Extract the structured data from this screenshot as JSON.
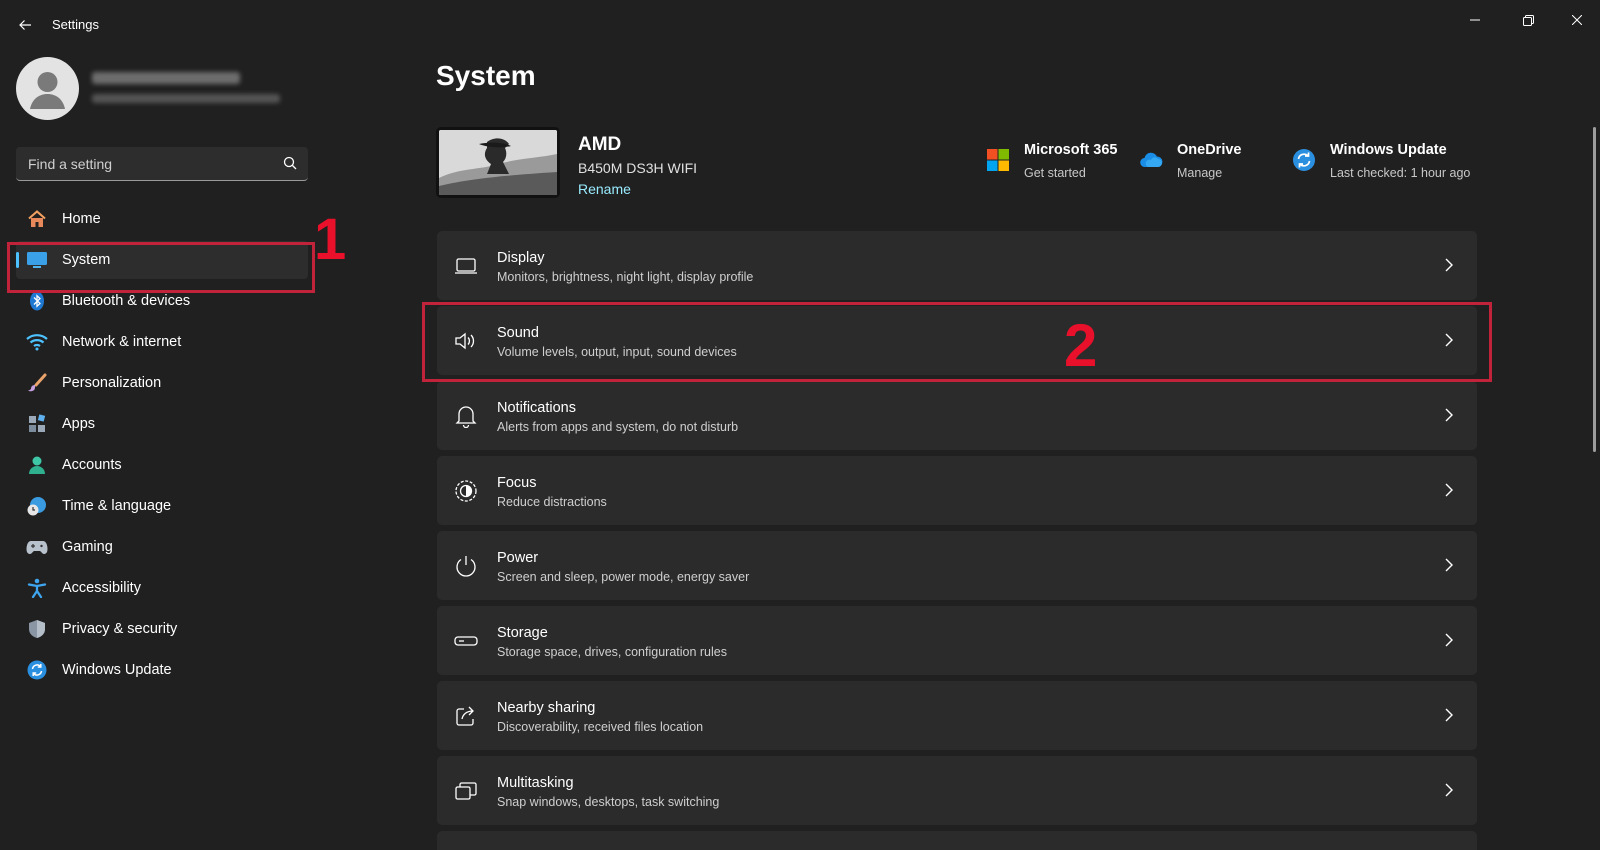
{
  "window": {
    "title": "Settings",
    "controls": [
      "minimize",
      "maximize",
      "close"
    ]
  },
  "search": {
    "placeholder": "Find a setting"
  },
  "sidebar": {
    "items": [
      {
        "label": "Home",
        "icon": "home-icon"
      },
      {
        "label": "System",
        "icon": "monitor-icon",
        "selected": true
      },
      {
        "label": "Bluetooth & devices",
        "icon": "bluetooth-icon"
      },
      {
        "label": "Network & internet",
        "icon": "wifi-icon"
      },
      {
        "label": "Personalization",
        "icon": "brush-icon"
      },
      {
        "label": "Apps",
        "icon": "apps-icon"
      },
      {
        "label": "Accounts",
        "icon": "person-icon"
      },
      {
        "label": "Time & language",
        "icon": "globe-clock-icon"
      },
      {
        "label": "Gaming",
        "icon": "gamepad-icon"
      },
      {
        "label": "Accessibility",
        "icon": "accessibility-icon"
      },
      {
        "label": "Privacy & security",
        "icon": "shield-icon"
      },
      {
        "label": "Windows Update",
        "icon": "update-icon"
      }
    ]
  },
  "main": {
    "title": "System",
    "device": {
      "name": "AMD",
      "model": "B450M DS3H WIFI",
      "rename": "Rename"
    },
    "quick_links": [
      {
        "title": "Microsoft 365",
        "sub": "Get started",
        "icon": "microsoft-365-icon"
      },
      {
        "title": "OneDrive",
        "sub": "Manage",
        "icon": "onedrive-icon"
      },
      {
        "title": "Windows Update",
        "sub": "Last checked: 1 hour ago",
        "icon": "windows-update-icon"
      }
    ],
    "cards": [
      {
        "title": "Display",
        "sub": "Monitors, brightness, night light, display profile",
        "icon": "display-icon"
      },
      {
        "title": "Sound",
        "sub": "Volume levels, output, input, sound devices",
        "icon": "speaker-icon"
      },
      {
        "title": "Notifications",
        "sub": "Alerts from apps and system, do not disturb",
        "icon": "bell-icon"
      },
      {
        "title": "Focus",
        "sub": "Reduce distractions",
        "icon": "focus-icon"
      },
      {
        "title": "Power",
        "sub": "Screen and sleep, power mode, energy saver",
        "icon": "power-icon"
      },
      {
        "title": "Storage",
        "sub": "Storage space, drives, configuration rules",
        "icon": "storage-icon"
      },
      {
        "title": "Nearby sharing",
        "sub": "Discoverability, received files location",
        "icon": "share-icon"
      },
      {
        "title": "Multitasking",
        "sub": "Snap windows, desktops, task switching",
        "icon": "multitasking-icon"
      }
    ]
  },
  "annotations": {
    "step1": "1",
    "step2": "2",
    "color": "#c0233a"
  },
  "colors": {
    "background": "#202020",
    "card": "#2b2b2b",
    "accent": "#4cc2ff",
    "link": "#99ebff"
  }
}
